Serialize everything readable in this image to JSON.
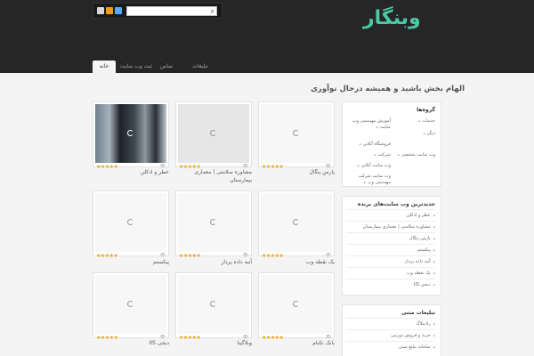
{
  "header": {
    "logo": "وبنگار",
    "search": {
      "value": "",
      "placeholder": ""
    },
    "social": [
      {
        "name": "mail-icon",
        "color": "#d9d9d9"
      },
      {
        "name": "rss-icon",
        "color": "#f39c12"
      },
      {
        "name": "twitter-icon",
        "color": "#55acee"
      }
    ]
  },
  "nav": {
    "items": [
      {
        "label": "خانه",
        "active": true
      },
      {
        "label": "ثبت وب سایت",
        "active": false
      },
      {
        "label": "تماس",
        "active": false
      },
      {
        "label": "تبلیغات",
        "active": false
      }
    ]
  },
  "tagline": "الهام بخش باشید و همیشه درحال نوآوری",
  "cards": [
    {
      "title": "پارس پنگال",
      "stars": "★★★★★",
      "views": "👁",
      "thumb": "blank"
    },
    {
      "title": "مشاوره سلامتی | معماری بیمارستان",
      "stars": "★★★★★",
      "views": "👁",
      "thumb": "gray"
    },
    {
      "title": "عطر و ادکلن",
      "stars": "★★★★★",
      "views": "👁",
      "thumb": "photo"
    },
    {
      "title": "یک نقطه وب",
      "stars": "★★★★★",
      "views": "👁",
      "thumb": "blank"
    },
    {
      "title": "آتیه داده پرداز",
      "stars": "★★★★★",
      "views": "👁",
      "thumb": "blank"
    },
    {
      "title": "پیکستم",
      "stars": "★★★★★",
      "views": "👁",
      "thumb": "blank"
    },
    {
      "title": "بانک تکنام",
      "stars": "★★★★★",
      "views": "👁",
      "thumb": "blank"
    },
    {
      "title": "وبلاگینا",
      "stars": "★★★★★",
      "views": "👁",
      "thumb": "blank"
    },
    {
      "title": "دیجی IIS",
      "stars": "★★★★★",
      "views": "👁",
      "thumb": "blank"
    }
  ],
  "sidebar": {
    "categories": {
      "title": "گروه‌ها",
      "items": [
        {
          "label": "خدمات"
        },
        {
          "label": "آموزش مهندسی وب سایت"
        },
        {
          "label": "دیگر"
        },
        {
          "label": "فروشگاه آنلاین"
        },
        {
          "label": "شرکت"
        },
        {
          "label": "وب سایت شخصی"
        },
        {
          "label": "وب سایت آنلاین"
        },
        {
          "label": "وب سایت شرکت مهندسی وب"
        }
      ]
    },
    "latest": {
      "title": "جدیدترین وب سایت‌های برنده",
      "items": [
        {
          "label": "عطر و ادکلن"
        },
        {
          "label": "مشاوره سلامتی | معماری بیمارستان"
        },
        {
          "label": "پارس پنگال"
        },
        {
          "label": "پیکستم"
        },
        {
          "label": "آتیه داده پرداز"
        },
        {
          "label": "یک نقطه وب"
        },
        {
          "label": "دیجی IIS"
        }
      ]
    },
    "ads": {
      "title": "تبلیغات متنی",
      "items": [
        {
          "label": "رادیبلاگ"
        },
        {
          "label": "خرید و فروش دوربین"
        },
        {
          "label": "سامانه تبلیغ متنی"
        }
      ]
    }
  }
}
